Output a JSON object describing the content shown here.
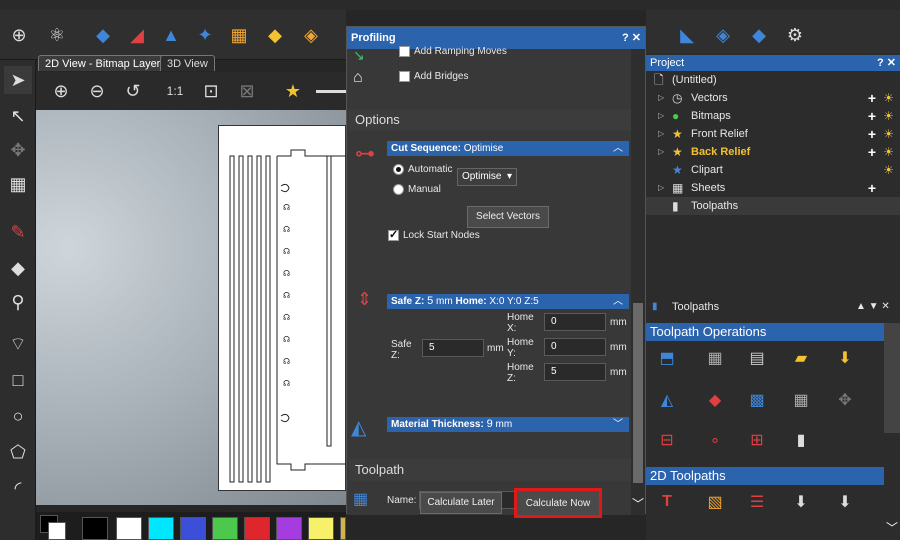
{
  "view_tabs": {
    "tab_2d": "2D View - Bitmap Layer",
    "tab_3d": "3D View"
  },
  "palette": {
    "colors": [
      "#000000",
      "#ffffff",
      "#00e6ff",
      "#3b4fd8",
      "#4cc84c",
      "#e0262d",
      "#a53ce0",
      "#f7f06a",
      "#cfb24a",
      "#f2c230"
    ]
  },
  "profiling": {
    "title": "Profiling",
    "controls": "? ✕",
    "add_ramping": "Add Ramping Moves",
    "add_bridges": "Add Bridges",
    "options_header": "Options",
    "cut_sequence_label": "Cut Sequence:",
    "cut_sequence_value": "Optimise",
    "automatic": "Automatic",
    "manual": "Manual",
    "select_value": "Optimise",
    "select_vectors": "Select Vectors",
    "lock_start_nodes": "Lock Start Nodes",
    "safez_label": "Safe Z:",
    "safez_value": "5",
    "safez_unit": "mm",
    "home_label": "Home:",
    "home_value": "X:0 Y:0 Z:5",
    "home_x_label": "Home X:",
    "home_x": "0",
    "home_y_label": "Home Y:",
    "home_y": "0",
    "home_z_label": "Home Z:",
    "home_z": "5",
    "safe_z_field_label": "Safe Z:",
    "safe_z_field": "5",
    "mm": "mm",
    "material_label": "Material Thickness:",
    "material_value": "9",
    "material_unit": "mm",
    "toolpath_header": "Toolpath",
    "name_label": "Name:",
    "name_value": "",
    "calc_later": "Calculate Later",
    "calc_now": "Calculate Now"
  },
  "project": {
    "title": "Project",
    "controls": "? ✕",
    "root": "(Untitled)",
    "items": [
      {
        "label": "Vectors",
        "bold": false,
        "color": "#e8e8e8"
      },
      {
        "label": "Bitmaps",
        "bold": false,
        "color": "#e8e8e8"
      },
      {
        "label": "Front Relief",
        "bold": false,
        "color": "#e8e8e8"
      },
      {
        "label": "Back Relief",
        "bold": true,
        "color": "#f2c230"
      },
      {
        "label": "Clipart",
        "bold": false,
        "color": "#e8e8e8"
      },
      {
        "label": "Sheets",
        "bold": false,
        "color": "#e8e8e8"
      },
      {
        "label": "Toolpaths",
        "bold": false,
        "color": "#e8e8e8"
      }
    ]
  },
  "toolpaths_panel": {
    "title": "Toolpaths",
    "operations_header": "Toolpath Operations",
    "toolpaths_2d_header": "2D Toolpaths"
  }
}
